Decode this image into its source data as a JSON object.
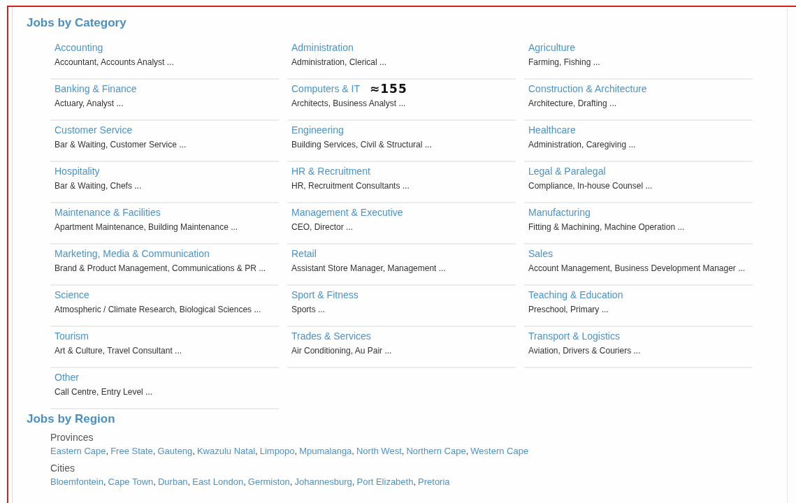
{
  "category_section": {
    "title": "Jobs by Category",
    "categories": [
      {
        "name": "Accounting",
        "examples": "Accountant, Accounts Analyst ..."
      },
      {
        "name": "Administration",
        "examples": "Administration, Clerical ..."
      },
      {
        "name": "Agriculture",
        "examples": "Farming, Fishing ..."
      },
      {
        "name": "Banking & Finance",
        "examples": "Actuary, Analyst ..."
      },
      {
        "name": "Computers & IT",
        "examples": "Architects, Business Analyst ...",
        "note": "≈155"
      },
      {
        "name": "Construction & Architecture",
        "examples": "Architecture, Drafting ..."
      },
      {
        "name": "Customer Service",
        "examples": "Bar & Waiting, Customer Service ..."
      },
      {
        "name": "Engineering",
        "examples": "Building Services, Civil & Structural ..."
      },
      {
        "name": "Healthcare",
        "examples": "Administration, Caregiving ..."
      },
      {
        "name": "Hospitality",
        "examples": "Bar & Waiting, Chefs ..."
      },
      {
        "name": "HR & Recruitment",
        "examples": "HR, Recruitment Consultants ..."
      },
      {
        "name": "Legal & Paralegal",
        "examples": "Compliance, In-house Counsel ..."
      },
      {
        "name": "Maintenance & Facilities",
        "examples": "Apartment Maintenance, Building Maintenance ..."
      },
      {
        "name": "Management & Executive",
        "examples": "CEO, Director ..."
      },
      {
        "name": "Manufacturing",
        "examples": "Fitting & Machining, Machine Operation ..."
      },
      {
        "name": "Marketing, Media & Communication",
        "examples": "Brand & Product Management, Communications & PR ..."
      },
      {
        "name": "Retail",
        "examples": "Assistant Store Manager, Management ..."
      },
      {
        "name": "Sales",
        "examples": "Account Management, Business Development Manager ..."
      },
      {
        "name": "Science",
        "examples": "Atmospheric / Climate Research, Biological Sciences ..."
      },
      {
        "name": "Sport & Fitness",
        "examples": "Sports ..."
      },
      {
        "name": "Teaching & Education",
        "examples": "Preschool, Primary ..."
      },
      {
        "name": "Tourism",
        "examples": "Art & Culture, Travel Consultant ..."
      },
      {
        "name": "Trades & Services",
        "examples": "Air Conditioning, Au Pair ..."
      },
      {
        "name": "Transport & Logistics",
        "examples": "Aviation, Drivers & Couriers ..."
      },
      {
        "name": "Other",
        "examples": "Call Centre, Entry Level ..."
      }
    ]
  },
  "region_section": {
    "title": "Jobs by Region",
    "separator": ",",
    "groups": [
      {
        "label": "Provinces",
        "links": [
          "Eastern Cape",
          "Free State",
          "Gauteng",
          "Kwazulu Natal",
          "Limpopo",
          "Mpumalanga",
          "North West",
          "Northern Cape",
          "Western Cape"
        ]
      },
      {
        "label": "Cities",
        "links": [
          "Bloemfontein",
          "Cape Town",
          "Durban",
          "East London",
          "Germiston",
          "Johannesburg",
          "Port Elizabeth",
          "Pretoria"
        ]
      }
    ]
  }
}
